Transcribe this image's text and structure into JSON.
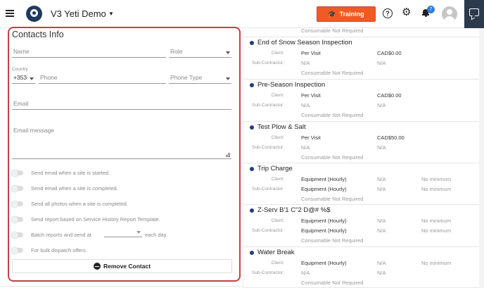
{
  "header": {
    "app_title": "V3 Yeti Demo",
    "training_label": "Training",
    "notification_count": "7",
    "colors": {
      "accent": "#f05a23",
      "brand": "#1f3a5c",
      "badge": "#2f7fd6",
      "card_border": "#c0404a"
    }
  },
  "contact": {
    "title": "Contacts Info",
    "name_placeholder": "Name",
    "role_placeholder": "Role",
    "country_label": "Country",
    "country_code": "+353",
    "phone_placeholder": "Phone",
    "phone_type_placeholder": "Phone Type",
    "email_placeholder": "Email",
    "email_message_placeholder": "Email message",
    "toggles": [
      "Send email when a site is started.",
      "Send email when a site is completed.",
      "Send all photos when a site is completed.",
      "Send report based on Service History Report Template.",
      "Batch reports and send at",
      "For bulk dispatch offers."
    ],
    "each_day": "each day.",
    "remove_label": "Remove Contact"
  },
  "services": {
    "top_note": "Consumable Not Required",
    "client_label": "Client:",
    "sub_label": "Sub-Contractor:",
    "items": [
      {
        "name": "End of Snow Season Inspection",
        "client_type": "Per Visit",
        "client_rate": "CAD$0.00",
        "client_min": "",
        "sub_type": "N/A",
        "sub_rate": "N/A",
        "sub_min": "",
        "note": "Consumable Not Required"
      },
      {
        "name": "Pre-Season Inspection",
        "client_type": "Per Visit",
        "client_rate": "CAD$0.00",
        "client_min": "",
        "sub_type": "N/A",
        "sub_rate": "N/A",
        "sub_min": "",
        "note": "Consumable Not Required"
      },
      {
        "name": "Test Plow & Salt",
        "client_type": "Per Visit",
        "client_rate": "CAD$50.00",
        "client_min": "",
        "sub_type": "N/A",
        "sub_rate": "N/A",
        "sub_min": "",
        "note": "Consumable Not Required"
      },
      {
        "name": "Trip Charge",
        "client_type": "Equipment (Hourly)",
        "client_rate": "N/A",
        "client_min": "No minimum",
        "sub_type": "Equipment (Hourly)",
        "sub_rate": "N/A",
        "sub_min": "No minimum",
        "note": "Consumable Not Required"
      },
      {
        "name": "Z-Serv B'1 C\"2 D@# %$",
        "client_type": "Equipment (Hourly)",
        "client_rate": "N/A",
        "client_min": "No minimum",
        "sub_type": "Equipment (Hourly)",
        "sub_rate": "N/A",
        "sub_min": "No minimum",
        "note": "Consumable Not Required"
      },
      {
        "name": "Water Break",
        "client_type": "Equipment (Hourly)",
        "client_rate": "N/A",
        "client_min": "No minimum",
        "sub_type": "N/A",
        "sub_rate": "N/A",
        "sub_min": "",
        "note": "Consumable Not Required"
      }
    ]
  }
}
